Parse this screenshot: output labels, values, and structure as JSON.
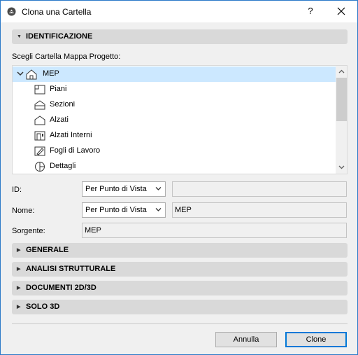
{
  "window": {
    "title": "Clona una Cartella",
    "help_label": "?",
    "close_label": "✕"
  },
  "identification": {
    "header": "IDENTIFICAZIONE",
    "choose_label": "Scegli Cartella Mappa Progetto:",
    "tree": [
      {
        "label": "MEP",
        "icon": "house-icon",
        "selected": true,
        "expanded": true
      },
      {
        "label": "Piani",
        "icon": "floor-plan-icon"
      },
      {
        "label": "Sezioni",
        "icon": "section-icon"
      },
      {
        "label": "Alzati",
        "icon": "elevation-icon"
      },
      {
        "label": "Alzati Interni",
        "icon": "interior-elevation-icon"
      },
      {
        "label": "Fogli di Lavoro",
        "icon": "worksheet-icon"
      },
      {
        "label": "Dettagli",
        "icon": "detail-icon"
      }
    ],
    "id_label": "ID:",
    "id_select": "Per Punto di Vista",
    "id_value": "",
    "name_label": "Nome:",
    "name_select": "Per Punto di Vista",
    "name_value": "MEP",
    "source_label": "Sorgente:",
    "source_value": "MEP"
  },
  "sections": [
    {
      "label": "GENERALE"
    },
    {
      "label": "ANALISI STRUTTURALE"
    },
    {
      "label": "DOCUMENTI 2D/3D"
    },
    {
      "label": "SOLO 3D"
    }
  ],
  "buttons": {
    "cancel": "Annulla",
    "clone": "Clone"
  }
}
